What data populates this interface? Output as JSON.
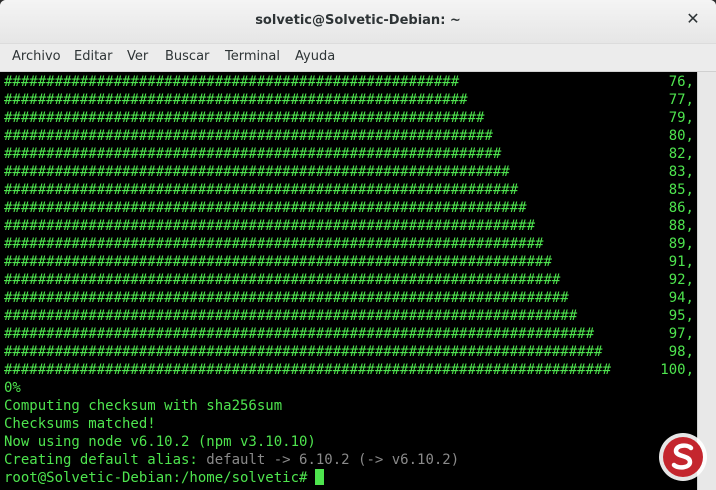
{
  "window": {
    "title": "solvetic@Solvetic-Debian: ~",
    "close_glyph": "✕"
  },
  "menu": {
    "items": [
      "Archivo",
      "Editar",
      "Ver",
      "Buscar",
      "Terminal",
      "Ayuda"
    ]
  },
  "terminal": {
    "progress_char": "#",
    "progress_rows": [
      {
        "hashes": 54,
        "percent": "76,"
      },
      {
        "hashes": 55,
        "percent": "77,"
      },
      {
        "hashes": 57,
        "percent": "79,"
      },
      {
        "hashes": 58,
        "percent": "80,"
      },
      {
        "hashes": 59,
        "percent": "82,"
      },
      {
        "hashes": 60,
        "percent": "83,"
      },
      {
        "hashes": 61,
        "percent": "85,"
      },
      {
        "hashes": 62,
        "percent": "86,"
      },
      {
        "hashes": 63,
        "percent": "88,"
      },
      {
        "hashes": 64,
        "percent": "89,"
      },
      {
        "hashes": 65,
        "percent": "91,"
      },
      {
        "hashes": 66,
        "percent": "92,"
      },
      {
        "hashes": 67,
        "percent": "94,"
      },
      {
        "hashes": 68,
        "percent": "95,"
      },
      {
        "hashes": 70,
        "percent": "97,"
      },
      {
        "hashes": 71,
        "percent": "98,"
      },
      {
        "hashes": 72,
        "percent": "100,"
      }
    ],
    "lines": [
      "0%",
      "Computing checksum with sha256sum",
      "Checksums matched!",
      "Now using node v6.10.2 (npm v3.10.10)"
    ],
    "alias_line": {
      "prefix": "Creating default alias: ",
      "detail": "default -> 6.10.2 (-> v6.10.2)"
    },
    "prompt": "root@Solvetic-Debian:/home/solvetic#"
  },
  "colors": {
    "terminal_fg": "#4ee44e",
    "terminal_bg": "#000000",
    "muted": "#8a8a8a"
  },
  "watermark_icon": "solvetic-logo-icon"
}
